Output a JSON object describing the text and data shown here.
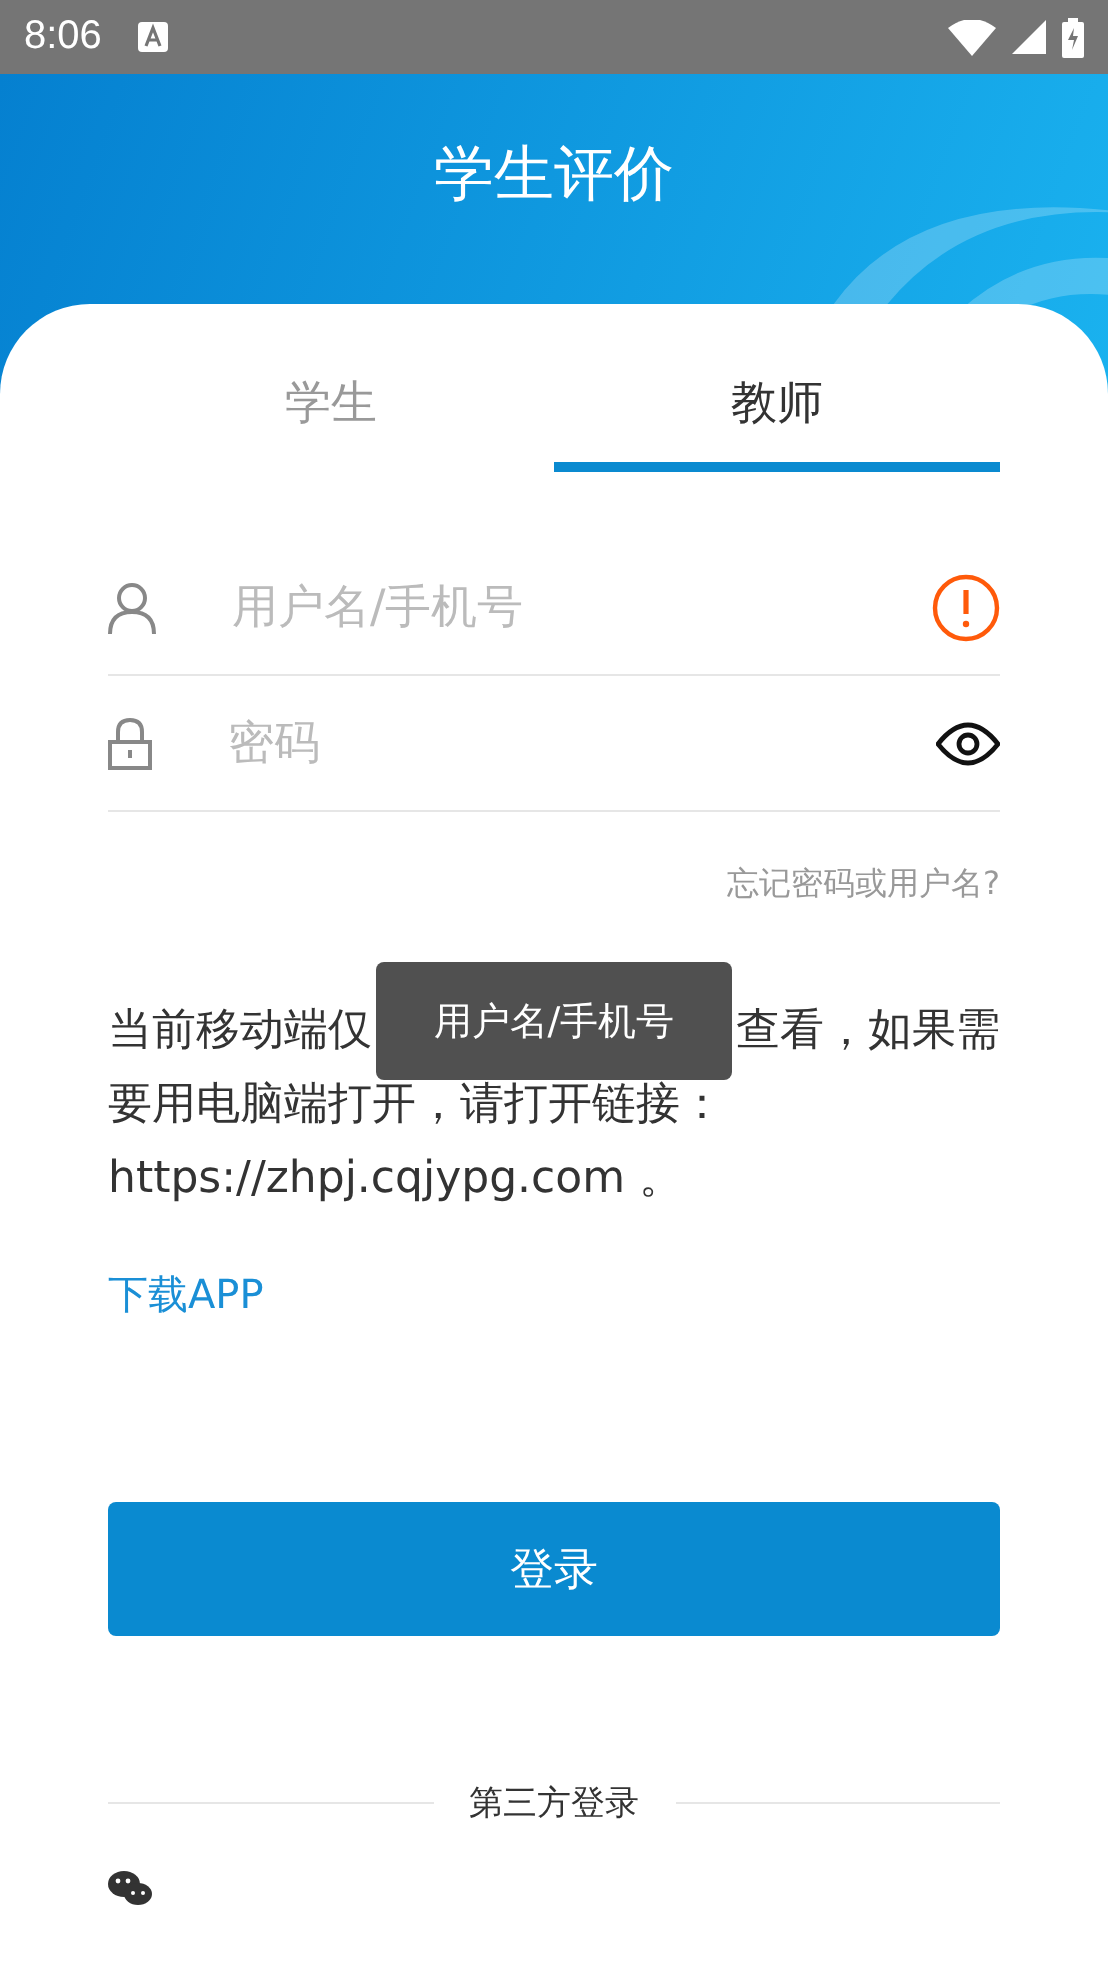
{
  "status_bar": {
    "time": "8:06"
  },
  "header": {
    "title": "学生评价"
  },
  "tabs": [
    {
      "label": "学生",
      "selected": false
    },
    {
      "label": "教师",
      "selected": true
    }
  ],
  "form": {
    "username": {
      "placeholder": "用户名/手机号",
      "error": true
    },
    "password": {
      "placeholder": "密码"
    },
    "forgot_link": "忘记密码或用户名?"
  },
  "notice": {
    "before_tooltip": "当前移动端仅",
    "after_tooltip": "查看，如果需",
    "rest": "要用电脑端打开，请打开链接：https://zhpj.cqjypg.com 。"
  },
  "download_link": "下载APP",
  "login_button": "登录",
  "third_party": {
    "label": "第三方登录"
  },
  "tooltip": "用户名/手机号"
}
